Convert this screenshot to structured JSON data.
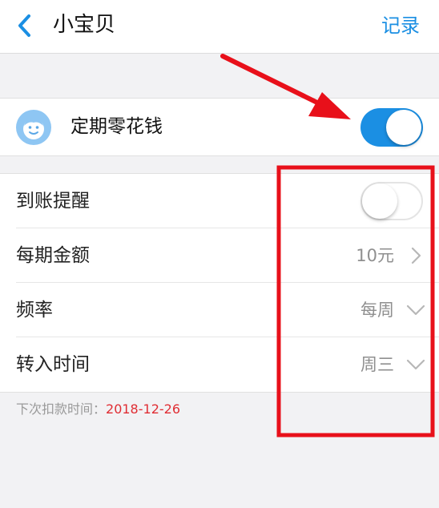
{
  "header": {
    "title": "小宝贝",
    "action_label": "记录"
  },
  "allowance": {
    "title": "定期零花钱",
    "enabled": true,
    "avatar_icon": "baby-face-icon"
  },
  "settings": [
    {
      "label": "到账提醒",
      "type": "toggle",
      "enabled": false
    },
    {
      "label": "每期金额",
      "value": "10元",
      "icon": "chevron-right-icon"
    },
    {
      "label": "频率",
      "value": "每周",
      "icon": "chevron-down-icon"
    },
    {
      "label": "转入时间",
      "value": "周三",
      "icon": "chevron-down-icon"
    }
  ],
  "footer": {
    "next_label": "下次扣款时间：",
    "next_date": "2018-12-26"
  },
  "colors": {
    "accent": "#1b8fe3",
    "annotation": "#e8101a",
    "date": "#e02d33"
  },
  "annotations": [
    "red-arrow",
    "red-box"
  ]
}
